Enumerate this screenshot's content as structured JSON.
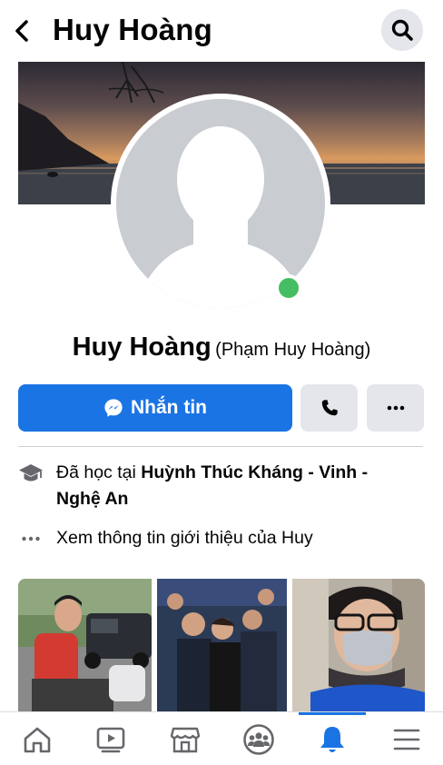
{
  "header": {
    "title": "Huy Hoàng",
    "back_icon": "chevron-left-icon",
    "search_icon": "search-icon"
  },
  "profile": {
    "name": "Huy Hoàng",
    "alternate_name": "(Phạm Huy Hoàng)",
    "online": true,
    "online_color": "#45bd62"
  },
  "actions": {
    "message_label": "Nhắn tin",
    "message_icon": "messenger-icon",
    "call_icon": "phone-icon",
    "more_icon": "more-dots-icon",
    "accent_color": "#1b74e4"
  },
  "intro": {
    "education_prefix": "Đã học tại",
    "education_school_line1": "Huỳnh Thúc Kháng - Vinh -",
    "education_school_line2": "Nghệ An",
    "education_icon": "graduation-cap-icon",
    "see_about_label": "Xem thông tin giới thiệu của Huy",
    "see_about_icon": "more-dots-icon"
  },
  "photos": {
    "items": [
      "photo-1",
      "photo-2",
      "photo-3"
    ]
  },
  "tabbar": {
    "items": [
      {
        "name": "home",
        "icon": "home-icon"
      },
      {
        "name": "watch",
        "icon": "video-icon"
      },
      {
        "name": "marketplace",
        "icon": "store-icon"
      },
      {
        "name": "groups",
        "icon": "groups-icon"
      },
      {
        "name": "notifications",
        "icon": "bell-icon",
        "active": true
      },
      {
        "name": "menu",
        "icon": "menu-icon"
      }
    ]
  }
}
